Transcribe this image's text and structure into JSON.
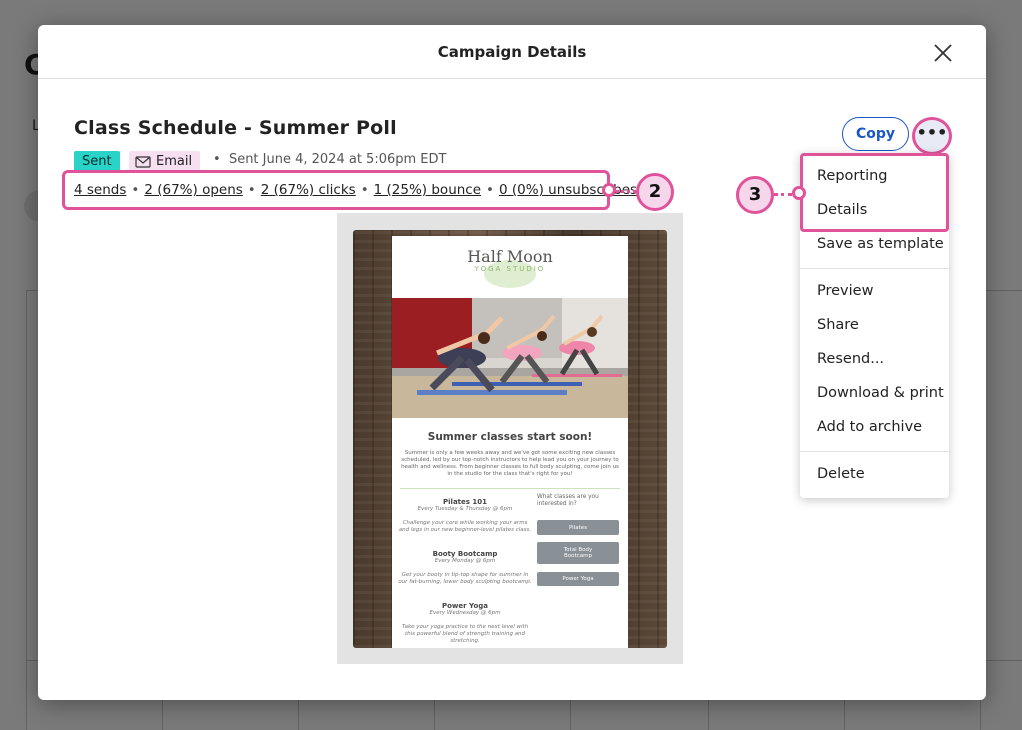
{
  "background": {
    "title_partial": "C",
    "tab_partial": "L"
  },
  "modal": {
    "title": "Campaign Details",
    "close_icon": "close-icon"
  },
  "campaign": {
    "name": "Class Schedule - Summer Poll",
    "status_badge": "Sent",
    "type_badge": "Email",
    "sent_text": "Sent June 4, 2024 at 5:06pm EDT",
    "stats": {
      "sends": "4 sends",
      "opens": "2 (67%) opens",
      "clicks": "2 (67%) clicks",
      "bounce": "1 (25%) bounce",
      "unsubscribes": "0 (0%) unsubscribes"
    }
  },
  "actions": {
    "copy_label": "Copy",
    "more_label": "•••"
  },
  "menu": {
    "items": [
      "Reporting",
      "Details",
      "Save as template",
      "Preview",
      "Share",
      "Resend...",
      "Download & print",
      "Add to archive",
      "Delete"
    ]
  },
  "callouts": {
    "stats_number": "2",
    "menu_number": "3"
  },
  "email_preview": {
    "logo_title": "Half Moon",
    "logo_subtitle": "YOGA STUDIO",
    "heading": "Summer classes start soon!",
    "intro": "Summer is only a few weeks away and we've got some exciting new classes scheduled, led by our top-notch instructors to help lead you on your journey to health and wellness. From beginner classes to full body sculpting, come join us in the studio for the class that's right for you!",
    "classes": [
      {
        "name": "Pilates 101",
        "time": "Every Tuesday & Thursday @ 6pm",
        "desc": "Challenge your core while working your arms and legs in our new beginner-level pilates class."
      },
      {
        "name": "Booty Bootcamp",
        "time": "Every Monday @ 6pm",
        "desc": "Get your booty in tip-top shape for summer in our fat-burning, lower body sculpting bootcamp."
      },
      {
        "name": "Power Yoga",
        "time": "Every Wednesday @ 6pm",
        "desc": "Take your yoga practice to the next level with this powerful blend of strength training and stretching."
      }
    ],
    "poll_question": "What classes are you interested in?",
    "poll_options": [
      "Pilates",
      "Total Body Bootcamp",
      "Power Yoga"
    ]
  },
  "colors": {
    "accent_highlight": "#e0529a",
    "sent_badge": "#29d3c8",
    "email_badge": "#f6dff1",
    "copy_button": "#1a56c8"
  }
}
